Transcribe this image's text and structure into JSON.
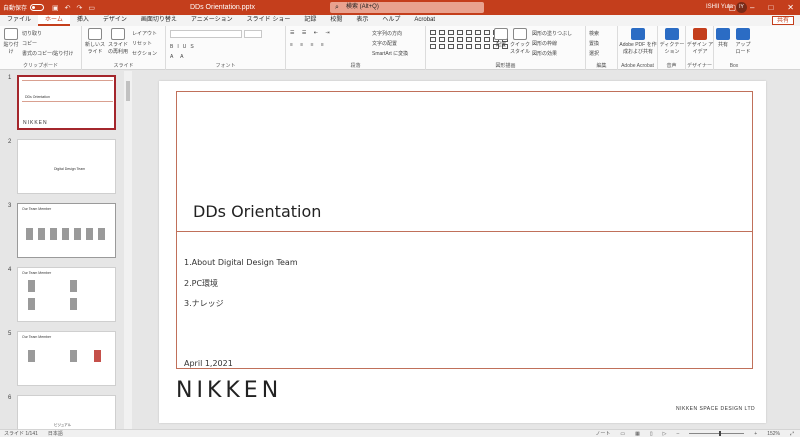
{
  "titlebar": {
    "autosave_label": "自動保存",
    "autosave_state": "オフ",
    "doc_title": "DDs Orientation.pptx",
    "search_placeholder": "検索 (Alt+Q)",
    "user_name": "ISHII Yuta",
    "user_initials": "IY"
  },
  "menu": {
    "tabs": [
      "ファイル",
      "ホーム",
      "挿入",
      "デザイン",
      "画面切り替え",
      "アニメーション",
      "スライド ショー",
      "記録",
      "校閲",
      "表示",
      "ヘルプ",
      "Acrobat"
    ],
    "active_index": 1,
    "share_label": "共有"
  },
  "ribbon": {
    "clipboard": {
      "paste": "貼り付け",
      "cut": "切り取り",
      "copy": "コピー",
      "format_painter": "書式のコピー/貼り付け",
      "group": "クリップボード"
    },
    "slides": {
      "new_slide": "新しいスライド",
      "reuse": "スライドの再利用",
      "layout": "レイアウト",
      "reset": "リセット",
      "section": "セクション",
      "group": "スライド"
    },
    "font": {
      "group": "フォント"
    },
    "paragraph": {
      "text_direction": "文字列の方向",
      "align_text": "文字の配置",
      "smartart": "SmartArt に変換",
      "group": "段落"
    },
    "drawing": {
      "arrange": "配置",
      "quick_styles": "クイック スタイル",
      "fill": "図形の塗りつぶし",
      "outline": "図形の枠線",
      "effects": "図形の効果",
      "group": "図形描画"
    },
    "editing": {
      "find": "検索",
      "replace": "置換",
      "select": "選択",
      "group": "編集"
    },
    "acrobat": {
      "create_pdf": "Adobe PDF を作成および共有",
      "group": "Adobe Acrobat"
    },
    "voice": {
      "dictate": "ディクテーション",
      "group": "音声"
    },
    "designer": {
      "design_ideas": "デザイン アイデア",
      "group": "デザイナー"
    },
    "box": {
      "share": "共有",
      "upload": "アップロード",
      "group": "Box"
    }
  },
  "thumbnails": [
    {
      "num": "1",
      "title": "DDs Orientation",
      "selected": true
    },
    {
      "num": "2",
      "title": "Digital Design Team",
      "selected": false
    },
    {
      "num": "3",
      "title": "Our Team Member",
      "selected": false
    },
    {
      "num": "4",
      "title": "Our Team Member",
      "selected": false
    },
    {
      "num": "5",
      "title": "Our Team Member",
      "selected": false
    },
    {
      "num": "6",
      "title": "ビジュアル",
      "selected": false
    }
  ],
  "slide": {
    "title": "DDs Orientation",
    "agenda": [
      "1.About Digital Design Team",
      "2.PC環境",
      "3.ナレッジ"
    ],
    "date": "April 1,2021",
    "logo": "NIKKEN",
    "company": "NIKKEN SPACE DESIGN LTD"
  },
  "status": {
    "slide_counter": "スライド 1/141",
    "language": "日本語",
    "notes": "ノート",
    "zoom": "152%"
  },
  "colors": {
    "accent": "#c43e1c",
    "slide_line": "#c0705a"
  }
}
